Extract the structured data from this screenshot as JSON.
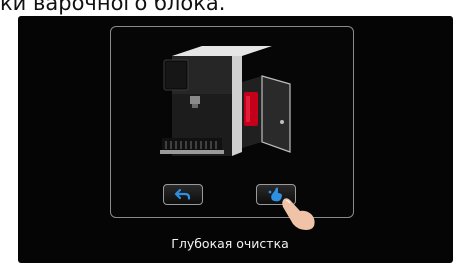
{
  "header": {
    "title_fragment": "ки варочного блока."
  },
  "screen": {
    "caption": "Глубокая очистка",
    "illustration": "coffee-machine-brew-unit-open",
    "buttons": {
      "back_icon": "back-arrow-icon",
      "clean_icon": "clean-hand-icon"
    },
    "colors": {
      "background": "#050505",
      "button_icon": "#2f8fe0",
      "panel_border": "#8a8a8a",
      "brew_unit": "#c4001a"
    }
  }
}
